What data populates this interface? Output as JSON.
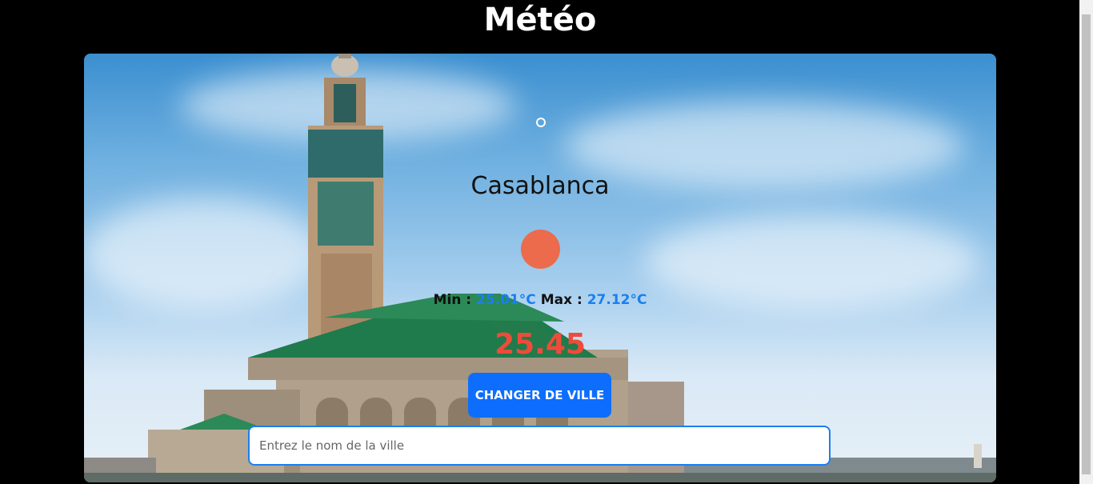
{
  "header": {
    "title": "Météo"
  },
  "weather": {
    "city": "Casablanca",
    "min_label": "Min :",
    "min_value": "25.01°C",
    "max_label": "Max :",
    "max_value": "27.12°C",
    "temperature": "25.45"
  },
  "actions": {
    "change_city_label": "CHANGER DE VILLE"
  },
  "search": {
    "placeholder": "Entrez le nom de la ville",
    "value": ""
  },
  "colors": {
    "primary": "#0d6efd",
    "value_blue": "#1a7ff0",
    "temperature_red": "#ef4b3a",
    "weather_icon": "#ec6b4c"
  },
  "background_image": {
    "subject": "Hassan II Mosque, Casablanca"
  }
}
